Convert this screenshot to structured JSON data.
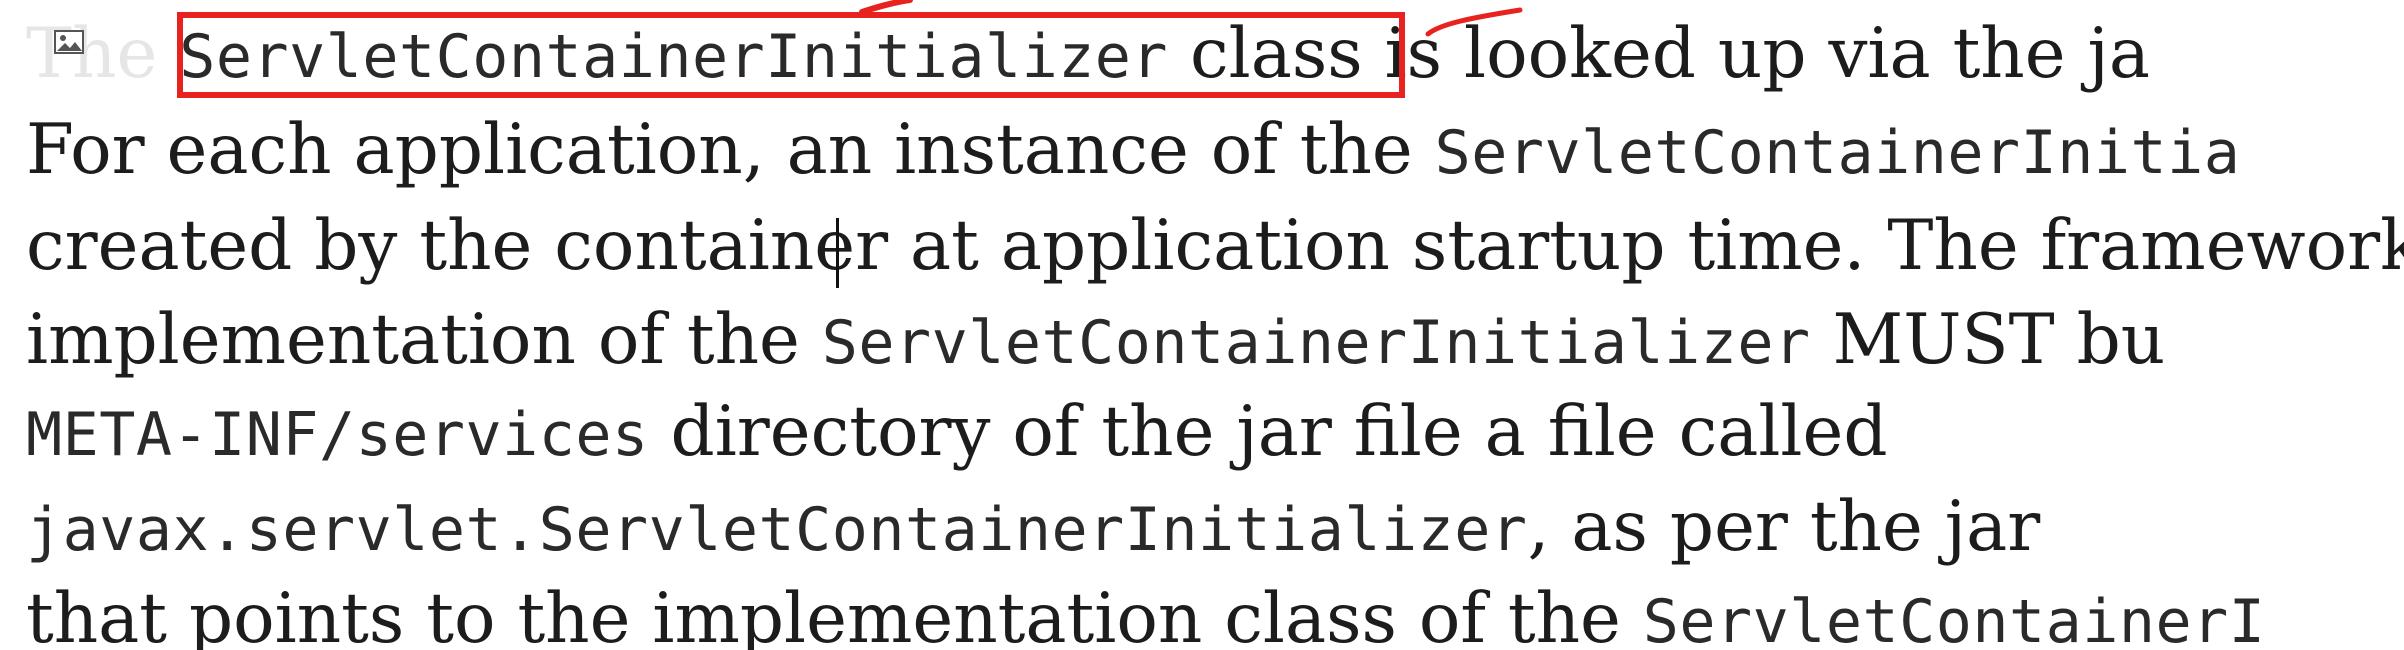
{
  "document": {
    "lines": [
      {
        "faded_prefix": "The",
        "code": "ServletContainerInitializer",
        "text_after": " class is looked up via the ja"
      },
      {
        "text_before": "For each application, an instance of the ",
        "code": "ServletContainerInitia"
      },
      {
        "text": "created by the container at application startup time. The framework"
      },
      {
        "text_before": "implementation of the ",
        "code": "ServletContainerInitializer",
        "text_after": " MUST bu"
      },
      {
        "code": "META-INF/services",
        "text_after": " directory of the jar file a file called"
      },
      {
        "code": "javax.servlet.ServletContainerInitializer",
        "text_after": ", as per the jar"
      },
      {
        "text_before": "that points to the implementation class of the ",
        "code": "ServletContainerI"
      }
    ]
  },
  "annotations": {
    "highlight_color": "#e8231f",
    "image_icon": "image-icon"
  }
}
